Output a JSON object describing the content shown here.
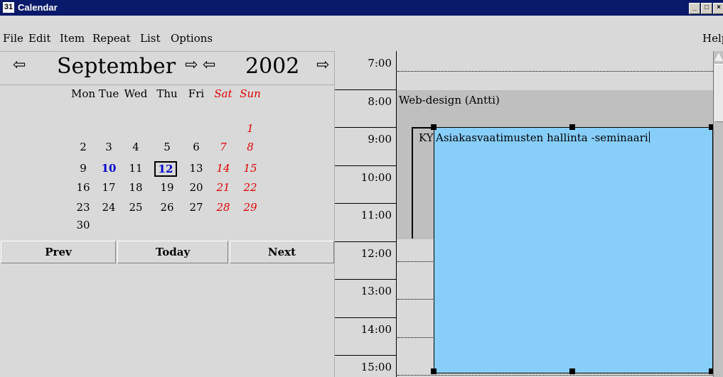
{
  "window": {
    "title": "Calendar",
    "app_icon": "calendar-app-icon",
    "controls": [
      "minimize",
      "maximize",
      "close"
    ]
  },
  "menu": {
    "items": [
      "File",
      "Edit",
      "Item",
      "Repeat",
      "List",
      "Options"
    ],
    "help": "Help"
  },
  "navigator": {
    "month": "September",
    "year": "2002",
    "arrow_glyph": "⇦",
    "arrow_glyph_right": "⇨"
  },
  "calendar": {
    "weekdays": [
      "Mon",
      "Tue",
      "Wed",
      "Thu",
      "Fri",
      "Sat",
      "Sun"
    ],
    "weeks": [
      [
        "",
        "",
        "",
        "",
        "",
        "",
        "1"
      ],
      [
        "2",
        "3",
        "4",
        "5",
        "6",
        "7",
        "8"
      ],
      [
        "9",
        "10",
        "11",
        "12",
        "13",
        "14",
        "15"
      ],
      [
        "16",
        "17",
        "18",
        "19",
        "20",
        "21",
        "22"
      ],
      [
        "23",
        "24",
        "25",
        "26",
        "27",
        "28",
        "29"
      ],
      [
        "30",
        "",
        "",
        "",
        "",
        "",
        ""
      ]
    ],
    "today": "10",
    "selected": "12",
    "colors": {
      "weekend": "#e00000",
      "today": "#0000cc"
    }
  },
  "buttons": {
    "prev": "Prev",
    "today": "Today",
    "next": "Next"
  },
  "dayview": {
    "hours": [
      "7:00",
      "8:00",
      "9:00",
      "10:00",
      "11:00",
      "12:00",
      "13:00",
      "14:00",
      "15:00"
    ],
    "events": [
      {
        "label": "Web-design (Antti)",
        "start": "8:00",
        "end": "12:00",
        "color": "#bfbfbf"
      },
      {
        "label": "KY",
        "start": "9:00",
        "end": "12:00"
      },
      {
        "label": "Asiakasvaatimusten hallinta -seminaari",
        "start": "9:00",
        "end": "15:30",
        "color": "#87cefa",
        "selected": true
      }
    ]
  }
}
